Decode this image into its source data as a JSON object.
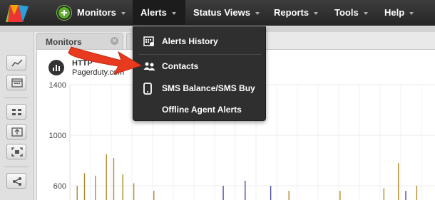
{
  "nav": {
    "items": [
      {
        "label": "Monitors"
      },
      {
        "label": "Alerts"
      },
      {
        "label": "Status Views"
      },
      {
        "label": "Reports"
      },
      {
        "label": "Tools"
      },
      {
        "label": "Help"
      }
    ]
  },
  "colors": {
    "topbar": "#2e2e2e",
    "accent_green": "#5fae2e",
    "arrow_red": "#e83a1e",
    "series_gold": "#b08a2a",
    "series_blue": "#4a48a8"
  },
  "tab": {
    "label": "Monitors",
    "close_icon": "close-icon"
  },
  "widget": {
    "title": "HTTP",
    "subtitle": "Pagerduty.com"
  },
  "alerts_menu": {
    "items": [
      {
        "label": "Alerts History",
        "icon": "calendar-alert-icon"
      },
      {
        "label": "Contacts",
        "icon": "contacts-icon"
      },
      {
        "label": "SMS Balance/SMS Buy",
        "icon": "mobile-phone-icon"
      },
      {
        "label": "Offline Agent Alerts",
        "icon": ""
      }
    ]
  },
  "chart_data": {
    "type": "bar",
    "title": "",
    "xlabel": "",
    "ylabel": "",
    "yticks": [
      "1400",
      "1000",
      "600"
    ],
    "ylim": [
      450,
      1400
    ],
    "grid": true,
    "series": [
      {
        "color": "#b08a2a",
        "values": [
          {
            "x": 0.02,
            "y": 600
          },
          {
            "x": 0.04,
            "y": 700
          },
          {
            "x": 0.07,
            "y": 680
          },
          {
            "x": 0.1,
            "y": 850
          },
          {
            "x": 0.12,
            "y": 820
          },
          {
            "x": 0.145,
            "y": 690
          },
          {
            "x": 0.175,
            "y": 620
          },
          {
            "x": 0.23,
            "y": 560
          },
          {
            "x": 0.6,
            "y": 560
          },
          {
            "x": 0.74,
            "y": 560
          },
          {
            "x": 0.86,
            "y": 580
          },
          {
            "x": 0.9,
            "y": 780
          },
          {
            "x": 0.95,
            "y": 600
          }
        ]
      },
      {
        "color": "#4a48a8",
        "values": [
          {
            "x": 0.42,
            "y": 600
          },
          {
            "x": 0.48,
            "y": 640
          },
          {
            "x": 0.55,
            "y": 600
          },
          {
            "x": 0.92,
            "y": 560
          }
        ]
      }
    ]
  }
}
